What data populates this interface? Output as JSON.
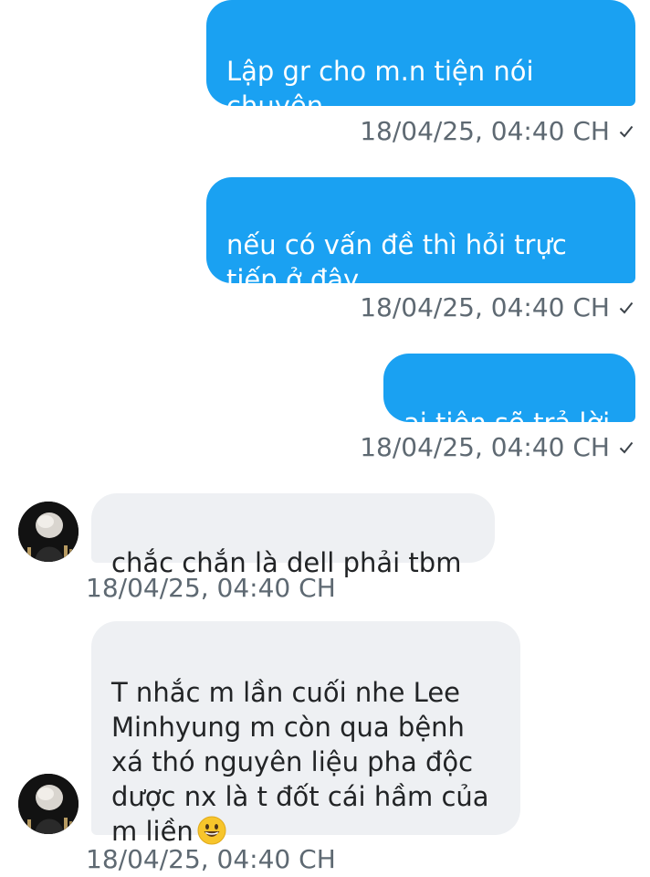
{
  "messages": [
    {
      "direction": "outgoing",
      "text": "Lập gr cho m.n tiện nói\nchuyện",
      "timestamp": "18/04/25, 04:40 CH",
      "status_icon": "check-icon"
    },
    {
      "direction": "outgoing",
      "text": "nếu có vấn đề thì hỏi trực\ntiếp ở đây",
      "timestamp": "18/04/25, 04:40 CH",
      "status_icon": "check-icon"
    },
    {
      "direction": "outgoing",
      "text": "ai tiện sẽ trả lời",
      "timestamp": "18/04/25, 04:40 CH",
      "status_icon": "check-icon"
    },
    {
      "direction": "incoming",
      "text": "chắc chắn là dell phải tbm",
      "timestamp": "18/04/25, 04:40 CH",
      "avatar": "user-avatar"
    },
    {
      "direction": "incoming",
      "text": "T nhắc m lần cuối nhe Lee\nMinhyung m còn qua bệnh\nxá thó nguyên liệu pha độc\ndược nx là t đốt cái hầm của\nm liền",
      "emoji": "grinning-face-emoji",
      "timestamp": "18/04/25, 04:40 CH",
      "avatar": "user-avatar"
    }
  ],
  "colors": {
    "outgoing_bubble": "#1aa1f2",
    "incoming_bubble": "#eef0f3",
    "timestamp_text": "#5e6972"
  }
}
